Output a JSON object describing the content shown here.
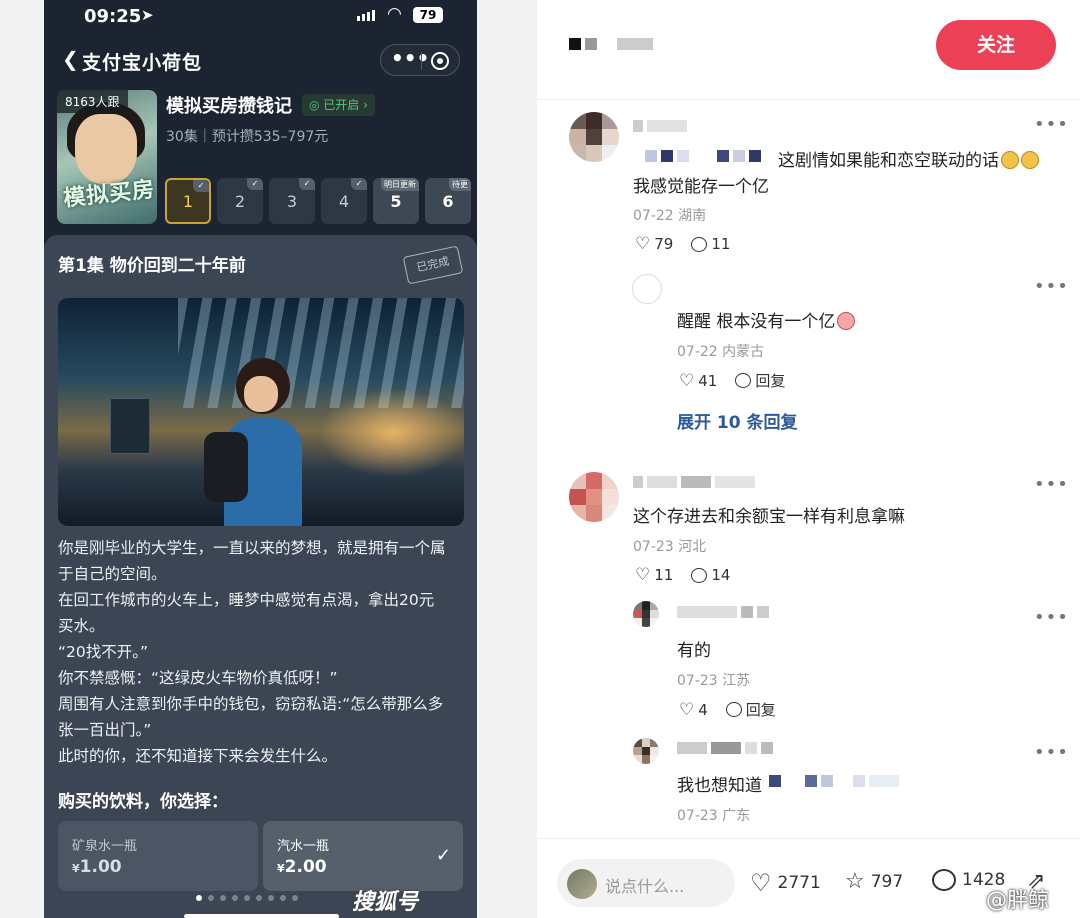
{
  "phone": {
    "time": "09:25",
    "battery": "79",
    "nav_title": "支付宝小荷包",
    "cover_follow": "8163人跟",
    "cover_art_text": "模拟买房",
    "book_title": "模拟买房攒钱记",
    "opened_label": "已开启",
    "book_sub": "30集｜预计攒535–797元",
    "episodes": [
      {
        "num": "1",
        "state": "active"
      },
      {
        "num": "2",
        "state": "done"
      },
      {
        "num": "3",
        "state": "done"
      },
      {
        "num": "4",
        "state": "done"
      },
      {
        "num": "5",
        "state": "tomorrow",
        "tag": "明日更新"
      },
      {
        "num": "6",
        "state": "pending",
        "tag": "待更"
      }
    ],
    "ep_title": "第1集  物价回到二十年前",
    "stamp": "已完成",
    "story": [
      "你是刚毕业的大学生，一直以来的梦想，就是拥有一个属\n于自己的空间。",
      "在回工作城市的火车上，睡梦中感觉有点渴，拿出20元\n买水。",
      "“20找不开。”",
      "你不禁感慨：“这绿皮火车物价真低呀！”",
      "周围有人注意到你手中的钱包，窃窃私语:“怎么带那么多\n张一百出门。”",
      "此时的你，还不知道接下来会发生什么。"
    ],
    "question": "购买的饮料，你选择：",
    "options": [
      {
        "name": "矿泉水一瓶",
        "currency": "¥",
        "price": "1.00",
        "selected": false
      },
      {
        "name": "汽水一瓶",
        "currency": "¥",
        "price": "2.00",
        "selected": true
      }
    ]
  },
  "right": {
    "follow_button": "关注",
    "comments": [
      {
        "text_line1": "这剧情如果能和恋空联动的话",
        "text_line2": "我感觉能存一个亿",
        "date": "07-22",
        "location": "湖南",
        "likes": "79",
        "replies": "11"
      },
      {
        "text": "醒醒 根本没有一个亿",
        "date": "07-22",
        "location": "内蒙古",
        "likes": "41",
        "reply_label": "回复"
      },
      {
        "text": "这个存进去和余额宝一样有利息拿嘛",
        "date": "07-23",
        "location": "河北",
        "likes": "11",
        "replies": "14"
      },
      {
        "text": "有的",
        "date": "07-23",
        "location": "江苏",
        "likes": "4",
        "reply_label": "回复"
      },
      {
        "text": "我也想知道",
        "date": "07-23",
        "location": "广东"
      }
    ],
    "expand_label": "展开 10 条回复",
    "input_placeholder": "说点什么...",
    "likes_total": "2771",
    "stars_total": "797",
    "comments_total": "1428",
    "watermark_left": "搜狐号",
    "watermark_right": "@胖鲸"
  }
}
